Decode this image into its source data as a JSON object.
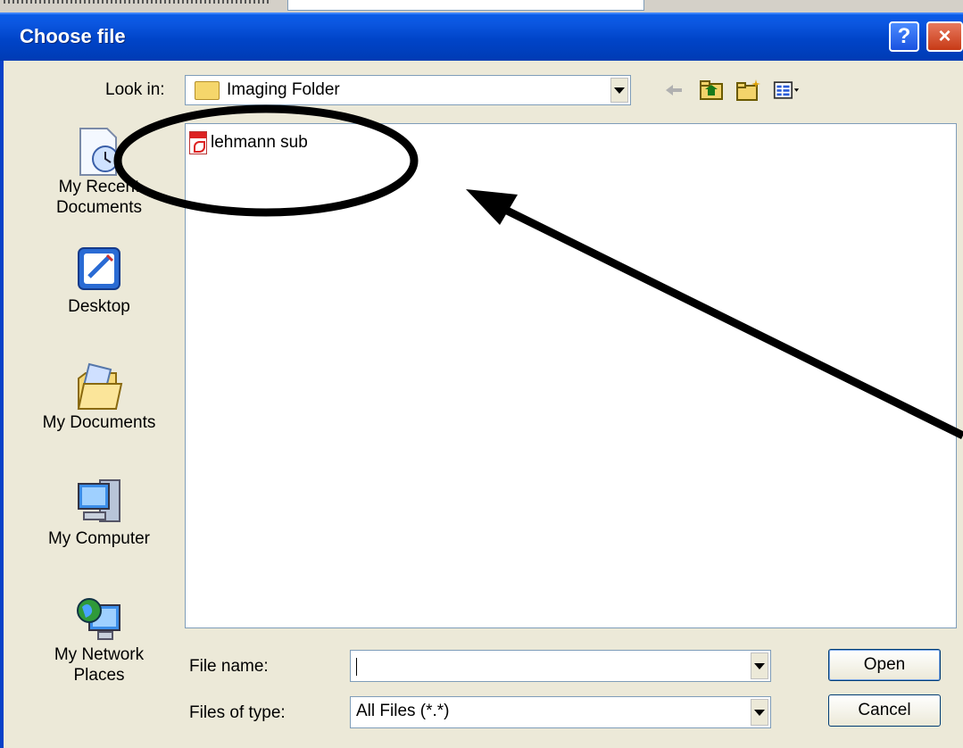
{
  "dialog": {
    "title": "Choose file",
    "help_label": "?",
    "close_label": "×"
  },
  "look_in": {
    "label": "Look in:",
    "value": "Imaging Folder"
  },
  "places": [
    {
      "label_line1": "My Recent",
      "label_line2": "Documents",
      "icon": "recent-documents-icon"
    },
    {
      "label_line1": "Desktop",
      "label_line2": "",
      "icon": "desktop-icon"
    },
    {
      "label_line1": "My Documents",
      "label_line2": "",
      "icon": "my-documents-icon"
    },
    {
      "label_line1": "My Computer",
      "label_line2": "",
      "icon": "my-computer-icon"
    },
    {
      "label_line1": "My Network",
      "label_line2": "Places",
      "icon": "network-places-icon"
    }
  ],
  "files": [
    {
      "name": "lehmann sub",
      "icon": "pdf-file-icon"
    }
  ],
  "file_name": {
    "label": "File name:",
    "value": ""
  },
  "file_type": {
    "label": "Files of type:",
    "value": "All Files (*.*)"
  },
  "buttons": {
    "open": "Open",
    "cancel": "Cancel"
  },
  "colors": {
    "title_bar": "#0044c8",
    "dialog_bg": "#ece9d8",
    "annotation": "#000000"
  }
}
